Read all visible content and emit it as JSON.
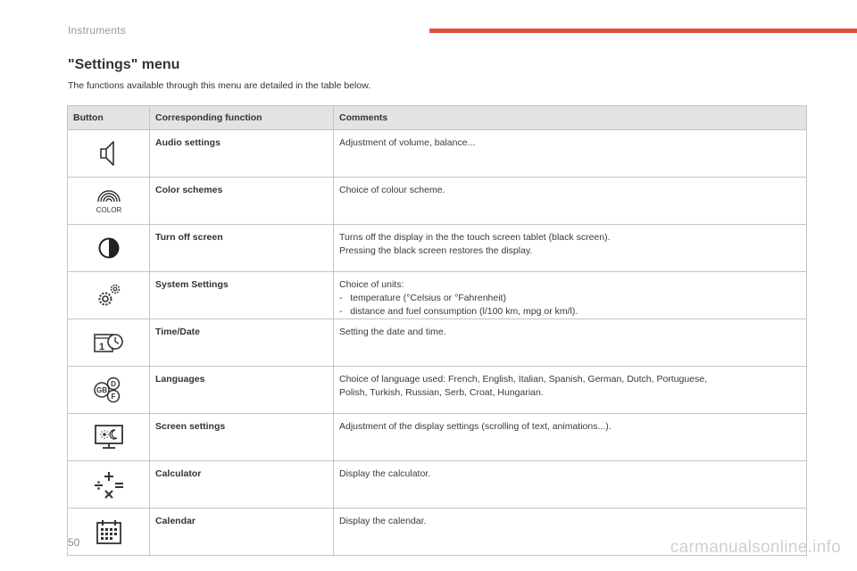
{
  "header": {
    "section": "Instruments",
    "accent_color": "#e0513d"
  },
  "title": "\"Settings\" menu",
  "intro": "The functions available through this menu are detailed in the table below.",
  "table": {
    "columns": [
      "Button",
      "Corresponding function",
      "Comments"
    ],
    "rows": [
      {
        "icon": "speaker-icon",
        "function": "Audio settings",
        "comments": [
          "Adjustment of volume, balance..."
        ]
      },
      {
        "icon": "color-palette-icon",
        "icon_label": "COLOR",
        "function": "Color schemes",
        "comments": [
          "Choice of colour scheme."
        ]
      },
      {
        "icon": "half-moon-screen-off-icon",
        "function": "Turn off screen",
        "comments": [
          "Turns off the display in the the touch screen tablet (black screen).",
          "Pressing the black screen restores the display."
        ]
      },
      {
        "icon": "gears-icon",
        "function": "System Settings",
        "comments": [
          "Choice of units:",
          "-   temperature (°Celsius or °Fahrenheit)",
          "-   distance and fuel consumption (l/100 km, mpg or km/l)."
        ]
      },
      {
        "icon": "calendar-clock-icon",
        "icon_label": "1",
        "function": "Time/Date",
        "comments": [
          "Setting the date and time."
        ]
      },
      {
        "icon": "language-flags-icon",
        "icon_labels": [
          "D",
          "GB",
          "F"
        ],
        "function": "Languages",
        "comments": [
          "Choice of language used: French, English, Italian, Spanish, German, Dutch, Portuguese,",
          "Polish, Turkish, Russian, Serb, Croat, Hungarian."
        ]
      },
      {
        "icon": "screen-day-night-icon",
        "function": "Screen settings",
        "comments": [
          "Adjustment of the display settings (scrolling of text, animations...)."
        ]
      },
      {
        "icon": "calculator-icon",
        "function": "Calculator",
        "comments": [
          "Display the calculator."
        ]
      },
      {
        "icon": "calendar-icon",
        "function": "Calendar",
        "comments": [
          "Display the calendar."
        ]
      }
    ]
  },
  "footer": {
    "page_number": "50",
    "watermark": "carmanualsonline.info"
  }
}
